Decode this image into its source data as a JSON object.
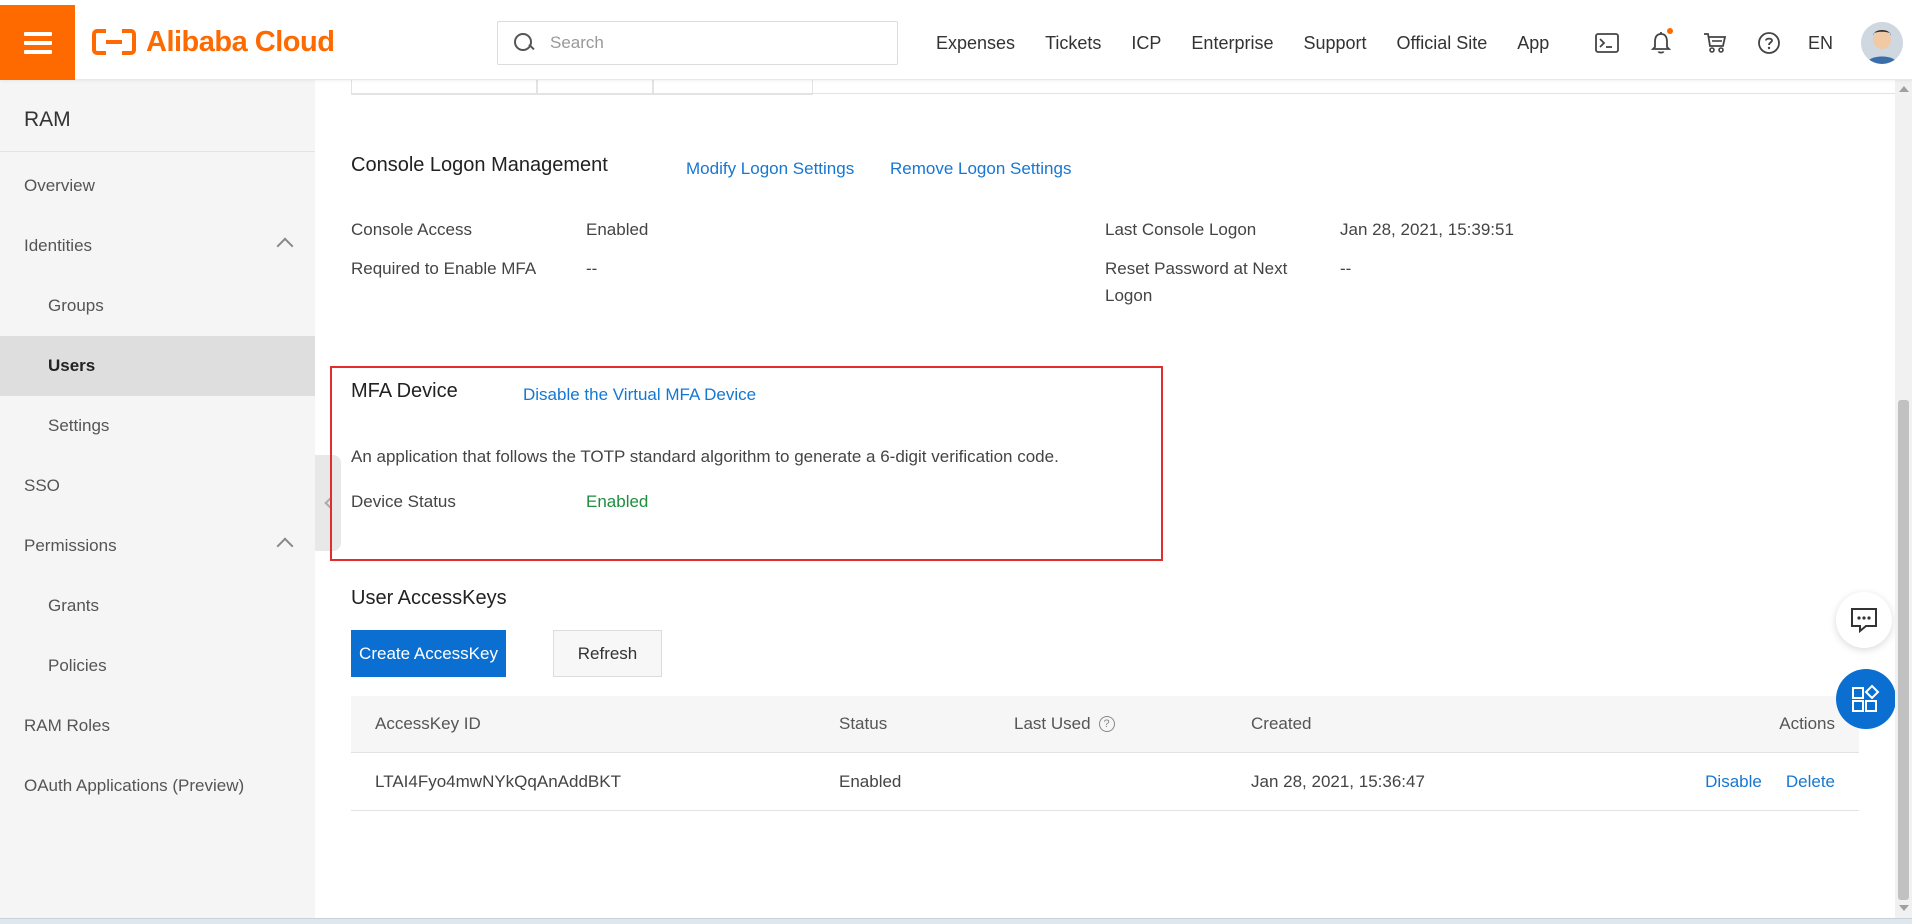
{
  "header": {
    "brand": "Alibaba Cloud",
    "search_placeholder": "Search",
    "nav": [
      "Expenses",
      "Tickets",
      "ICP",
      "Enterprise",
      "Support",
      "Official Site",
      "App"
    ],
    "lang": "EN",
    "icons": [
      "terminal-icon",
      "bell-icon",
      "cart-icon",
      "help-icon"
    ],
    "accent": "#ff6a00"
  },
  "sidebar": {
    "title": "RAM",
    "items": [
      {
        "label": "Overview"
      },
      {
        "label": "Identities"
      },
      {
        "label": "Groups"
      },
      {
        "label": "Users"
      },
      {
        "label": "Settings"
      },
      {
        "label": "SSO"
      },
      {
        "label": "Permissions"
      },
      {
        "label": "Grants"
      },
      {
        "label": "Policies"
      },
      {
        "label": "RAM Roles"
      },
      {
        "label": "OAuth Applications (Preview)"
      }
    ],
    "active": "Users"
  },
  "console_logon": {
    "title": "Console Logon Management",
    "modify_link": "Modify Logon Settings",
    "remove_link": "Remove Logon Settings",
    "fields": {
      "console_access_label": "Console Access",
      "console_access_value": "Enabled",
      "mfa_required_label": "Required to Enable MFA",
      "mfa_required_value": "--",
      "last_logon_label": "Last Console Logon",
      "last_logon_value": "Jan 28, 2021, 15:39:51",
      "reset_pw_label_line1": "Reset Password at Next",
      "reset_pw_label_line2": "Logon",
      "reset_pw_value": "--"
    }
  },
  "mfa_device": {
    "title": "MFA Device",
    "disable_link": "Disable the Virtual MFA Device",
    "description": "An application that follows the TOTP standard algorithm to generate a 6-digit verification code.",
    "status_label": "Device Status",
    "status_value": "Enabled",
    "highlight_color": "#e02e2e"
  },
  "access_keys": {
    "title": "User AccessKeys",
    "create_button": "Create AccessKey",
    "refresh_button": "Refresh",
    "columns": {
      "id": "AccessKey ID",
      "status": "Status",
      "last_used": "Last Used",
      "created": "Created",
      "actions": "Actions"
    },
    "rows": [
      {
        "id": "LTAI4Fyo4mwNYkQqAnAddBKT",
        "status": "Enabled",
        "last_used": "",
        "created": "Jan 28, 2021, 15:36:47",
        "action_disable": "Disable",
        "action_delete": "Delete"
      }
    ]
  }
}
